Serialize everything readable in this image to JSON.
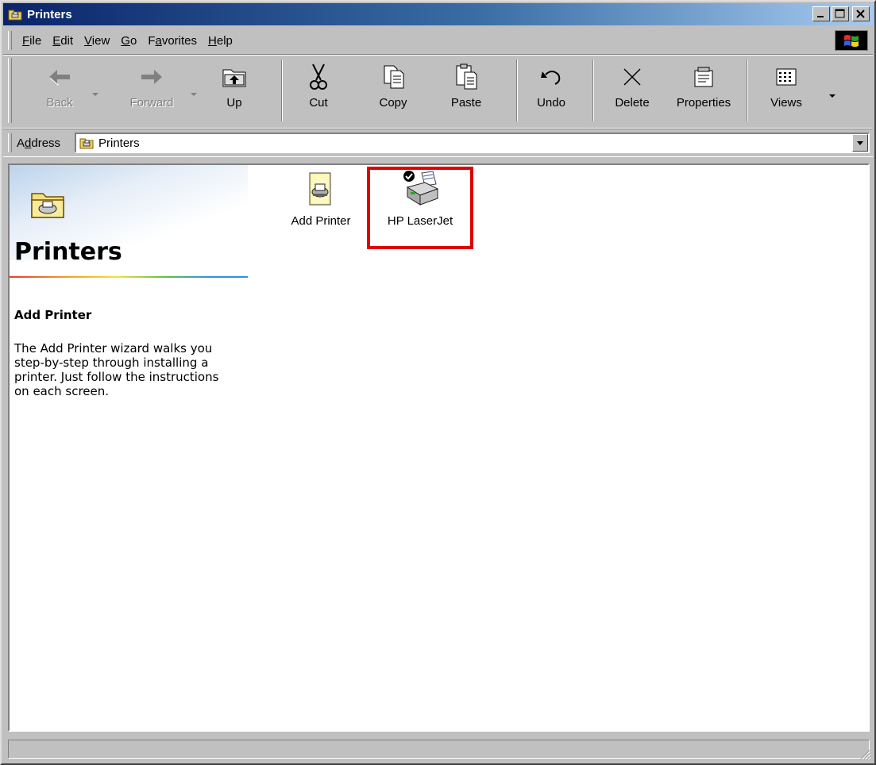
{
  "window": {
    "title": "Printers"
  },
  "menu": {
    "items": [
      {
        "label": "File",
        "key": "F",
        "rest": "ile"
      },
      {
        "label": "Edit",
        "key": "E",
        "rest": "dit"
      },
      {
        "label": "View",
        "key": "V",
        "rest": "iew"
      },
      {
        "label": "Go",
        "key": "G",
        "rest": "o"
      },
      {
        "label": "Favorites",
        "key": "a",
        "pre": "F",
        "rest": "vorites"
      },
      {
        "label": "Help",
        "key": "H",
        "rest": "elp"
      }
    ]
  },
  "toolbar": {
    "back": "Back",
    "forward": "Forward",
    "up": "Up",
    "cut": "Cut",
    "copy": "Copy",
    "paste": "Paste",
    "undo": "Undo",
    "delete": "Delete",
    "properties": "Properties",
    "views": "Views"
  },
  "address": {
    "label_pre": "A",
    "label_key": "d",
    "label_rest": "dress",
    "value": "Printers"
  },
  "left_pane": {
    "title": "Printers",
    "section_title": "Add Printer",
    "description": "The Add Printer wizard walks you step-by-step through installing a printer. Just follow the instructions on each screen."
  },
  "items": [
    {
      "label": "Add Printer"
    },
    {
      "label": "HP LaserJet"
    }
  ],
  "colors": {
    "title_bar_start": "#0a246a",
    "title_bar_end": "#a6caf0",
    "highlight": "#e00000"
  }
}
